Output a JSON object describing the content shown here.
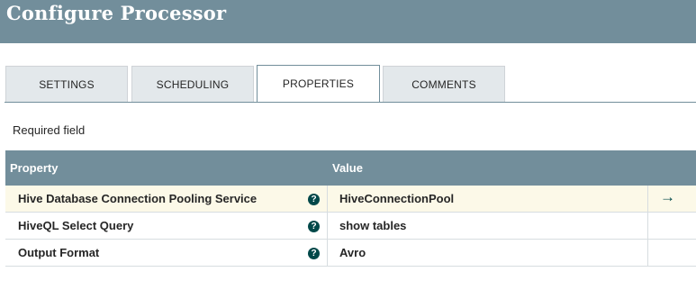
{
  "header": {
    "title": "Configure Processor"
  },
  "tabs": [
    {
      "label": "SETTINGS",
      "active": false
    },
    {
      "label": "SCHEDULING",
      "active": false
    },
    {
      "label": "PROPERTIES",
      "active": true
    },
    {
      "label": "COMMENTS",
      "active": false
    }
  ],
  "required_label": "Required field",
  "grid": {
    "columns": {
      "property": "Property",
      "value": "Value"
    },
    "rows": [
      {
        "name": "Hive Database Connection Pooling Service",
        "value": "HiveConnectionPool",
        "selected": true,
        "action_icon": "arrow-right-icon"
      },
      {
        "name": "HiveQL Select Query",
        "value": "show tables",
        "selected": false
      },
      {
        "name": "Output Format",
        "value": "Avro",
        "selected": false
      }
    ]
  },
  "icons": {
    "help": "?",
    "goto": "→"
  },
  "colors": {
    "header_bg": "#728e9b",
    "accent": "#004849",
    "selected_row": "#fcf9e8",
    "tab_inactive": "#e3e8eb"
  }
}
